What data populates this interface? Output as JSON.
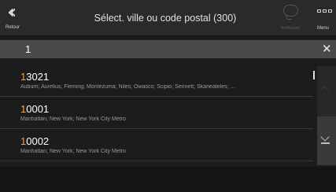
{
  "header": {
    "back_label": "Retour",
    "title": "Sélect. ville ou code postal (300)",
    "notification_label": "Notification",
    "menu_label": "Menu"
  },
  "search": {
    "query": "1"
  },
  "results": [
    {
      "code_match": "1",
      "code_rest": "3021",
      "cities": "Auburn; Aurelius; Fleming; Montezuma; Niles; Owasco; Scipio; Sennett; Skaneateles; ..."
    },
    {
      "code_match": "1",
      "code_rest": "0001",
      "cities": "Manhattan; New York; New York City Metro"
    },
    {
      "code_match": "1",
      "code_rest": "0002",
      "cities": "Manhattan; New York; New York City Metro"
    }
  ],
  "icons": {
    "back": "double-chevron-left-icon",
    "notification": "speech-bubble-icon",
    "menu": "grid-icon",
    "clear": "close-icon",
    "scroll_up": "chevron-up-icon",
    "scroll_down": "chevron-down-bar-icon"
  },
  "colors": {
    "highlight": "#f5a623",
    "background": "#1c1c1c",
    "topbar": "#2a2a2a",
    "searchbar": "#4a4a4a",
    "secondary_text": "#9a9a9a"
  }
}
